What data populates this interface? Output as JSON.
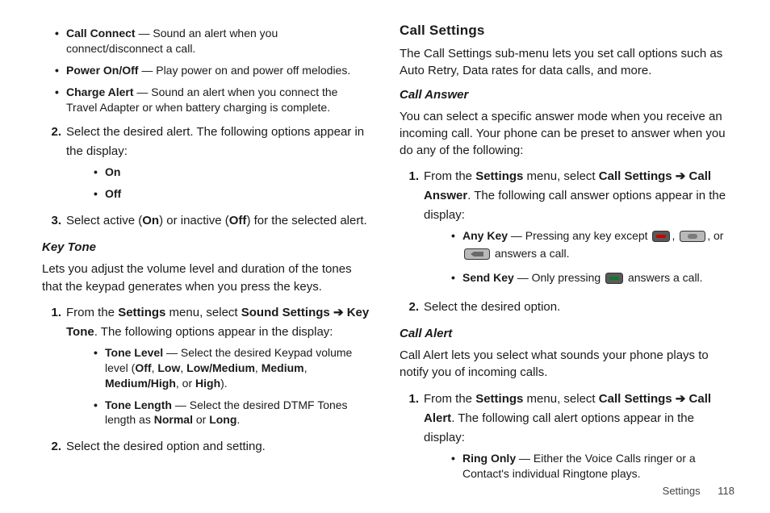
{
  "left": {
    "top_bullets": [
      {
        "term": "Call Connect",
        "desc": " — Sound an alert when you connect/disconnect a call."
      },
      {
        "term": "Power On/Off",
        "desc": " — Play power on and power off melodies."
      },
      {
        "term": "Charge Alert",
        "desc": " — Sound an alert when you connect the Travel Adapter or when battery charging is complete."
      }
    ],
    "step2_marker": "2.",
    "step2_text": "Select the desired alert. The following options appear in the display:",
    "on_off": [
      {
        "label": "On"
      },
      {
        "label": "Off"
      }
    ],
    "step3_marker": "3.",
    "step3_pre": "Select active (",
    "step3_on": "On",
    "step3_mid": ") or inactive (",
    "step3_off": "Off",
    "step3_post": ") for the selected alert.",
    "key_tone_heading": "Key Tone",
    "key_tone_intro": "Lets you adjust the volume level and duration of the tones that the keypad generates when you press the keys.",
    "kt1_marker": "1.",
    "kt1_pre": "From the ",
    "kt1_settings": "Settings",
    "kt1_mid": " menu, select ",
    "kt1_path1": "Sound Settings",
    "kt1_path2": "Key Tone",
    "kt1_post": ". The following options appear in the display:",
    "kt_bullets": [
      {
        "term": "Tone Level",
        "desc_pre": " — Select the desired Keypad volume level (",
        "opts": [
          "Off",
          "Low",
          "Low/Medium",
          "Medium",
          "Medium/High"
        ],
        "or": ", or ",
        "last": "High",
        "desc_post": ")."
      },
      {
        "term": "Tone Length",
        "desc_pre": " — Select the desired DTMF Tones length as ",
        "opts": [
          "Normal"
        ],
        "or": " or ",
        "last": "Long",
        "desc_post": "."
      }
    ],
    "kt2_marker": "2.",
    "kt2_text": "Select the desired option and setting."
  },
  "right": {
    "cs_heading": "Call Settings",
    "cs_intro": "The Call Settings sub-menu lets you set call options such as Auto Retry, Data rates for data calls, and more.",
    "ca_heading": "Call Answer",
    "ca_intro": "You can select a specific answer mode when you receive an incoming call. Your phone can be preset to answer when you do any of the following:",
    "ca1_marker": "1.",
    "ca1_pre": "From the ",
    "ca1_settings": "Settings",
    "ca1_mid": " menu, select ",
    "ca1_path1": "Call Settings",
    "ca1_path2": "Call Answer",
    "ca1_post": ". The following call answer options appear in the display:",
    "ca_bullets": {
      "any_key": {
        "term": "Any Key",
        "desc_pre": " — Pressing any key except ",
        "sep": ", ",
        "or": ", or ",
        "desc_post": " answers a call."
      },
      "send_key": {
        "term": "Send Key",
        "desc_pre": " — Only pressing ",
        "desc_post": " answers a call."
      }
    },
    "ca2_marker": "2.",
    "ca2_text": "Select the desired option.",
    "cal_heading": "Call Alert",
    "cal_intro": "Call Alert lets you select what sounds your phone plays to notify you of incoming calls.",
    "cal1_marker": "1.",
    "cal1_pre": "From the ",
    "cal1_settings": "Settings",
    "cal1_mid": " menu, select ",
    "cal1_path1": "Call Settings",
    "cal1_path2": "Call Alert",
    "cal1_post": ". The following call alert options appear in the display:",
    "cal_bullets": [
      {
        "term": "Ring Only",
        "desc": " — Either the Voice Calls ringer or a Contact's individual Ringtone plays."
      }
    ]
  },
  "footer": {
    "section": "Settings",
    "page": "118"
  },
  "arrow": "➔"
}
